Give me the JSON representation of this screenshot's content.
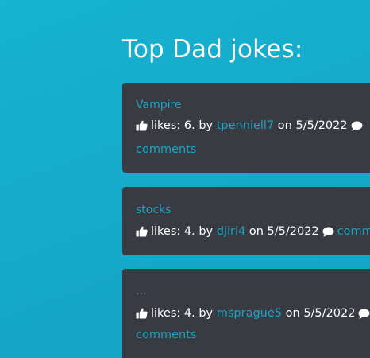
{
  "page": {
    "title": "Top Dad jokes:"
  },
  "jokes": [
    {
      "title": "Vampire",
      "likes_text": "likes: 6. by",
      "author": "tpenniell7",
      "on_text": "on",
      "date": "5/5/2022",
      "comments_label": "comments"
    },
    {
      "title": "stocks",
      "likes_text": "likes: 4. by",
      "author": "djiri4",
      "on_text": "on",
      "date": "5/5/2022",
      "comments_label": "comm"
    },
    {
      "title": "...",
      "likes_text": "likes: 4. by",
      "author": "msprague5",
      "on_text": "on",
      "date": "5/5/2022",
      "comments_label": "comments"
    }
  ],
  "icons": {
    "like": "thumbs-up-icon",
    "comment": "comment-bubble-icon"
  },
  "colors": {
    "background": "#16aacb",
    "card": "#393b42",
    "link": "#1ba3c4",
    "text": "#ffffff"
  }
}
